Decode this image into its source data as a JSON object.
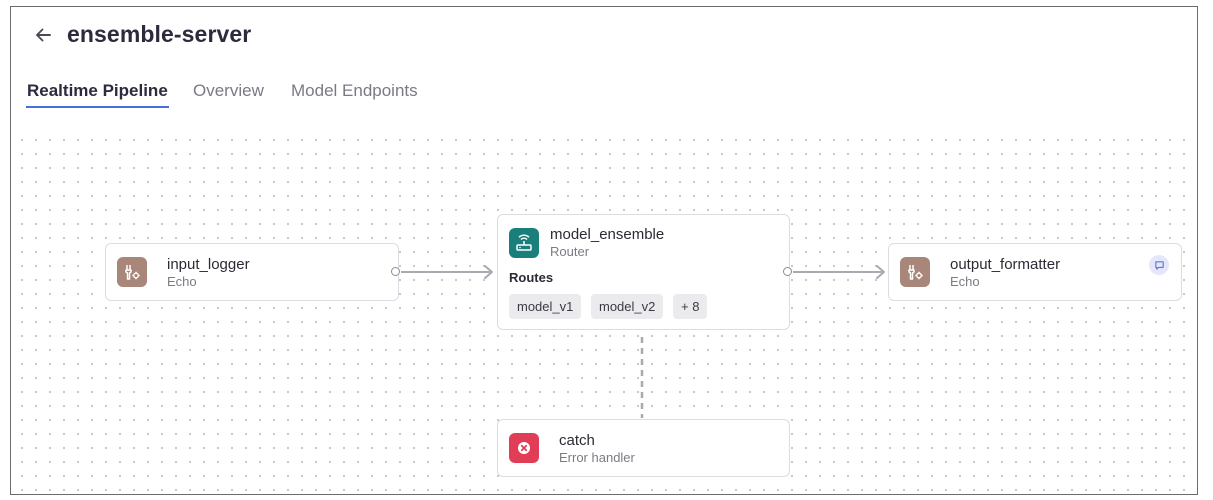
{
  "header": {
    "back_icon": "arrow-left-icon",
    "title": "ensemble-server"
  },
  "tabs": [
    {
      "label": "Realtime Pipeline",
      "active": true
    },
    {
      "label": "Overview",
      "active": false
    },
    {
      "label": "Model Endpoints",
      "active": false
    }
  ],
  "nodes": {
    "input_logger": {
      "name": "input_logger",
      "type": "Echo",
      "icon": "wrench-gear-icon",
      "icon_color": "#a8877a"
    },
    "model_ensemble": {
      "name": "model_ensemble",
      "type": "Router",
      "icon": "router-icon",
      "icon_color": "#1a7f7a",
      "routes_label": "Routes",
      "routes": [
        "model_v1",
        "model_v2"
      ],
      "more_routes": "+ 8"
    },
    "output_formatter": {
      "name": "output_formatter",
      "type": "Echo",
      "icon": "wrench-gear-icon",
      "icon_color": "#a8877a",
      "badge_icon": "comment-icon"
    },
    "catch": {
      "name": "catch",
      "type": "Error handler",
      "icon": "error-x-icon",
      "icon_color": "#e23d56"
    }
  },
  "colors": {
    "tab_underline": "#4a6fd6",
    "edge": "#a9a9b0",
    "canvas_dot": "#b9b9c2"
  }
}
